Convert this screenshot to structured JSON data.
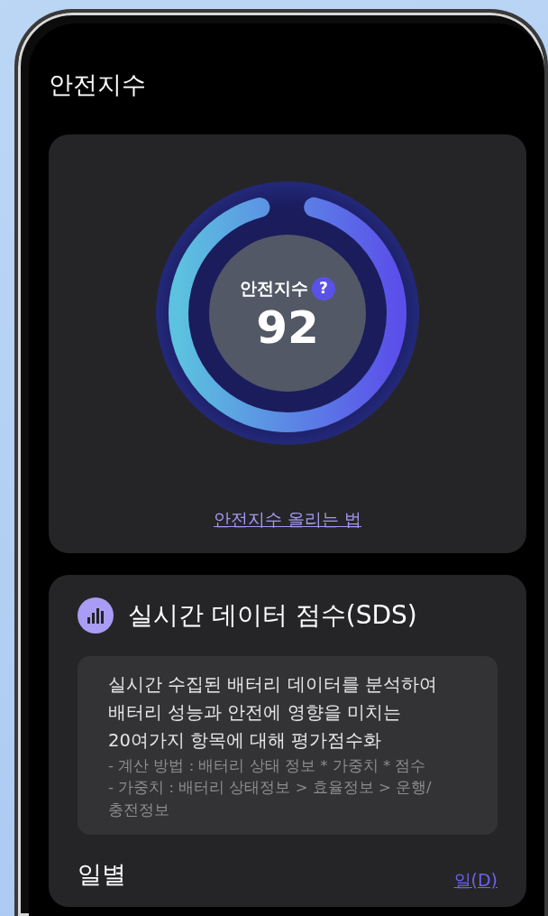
{
  "header": {
    "title": "안전지수"
  },
  "score_card": {
    "gauge": {
      "label": "안전지수",
      "help": "?",
      "score": "92",
      "level": 0.92
    },
    "link": "안전지수 올리는 법"
  },
  "sds_card": {
    "title": "실시간 데이터 점수(SDS)",
    "description": "실시간 수집된 배터리 데이터를 분석하여 배터리 성능과 안전에 영향을 미치는 20여가지 항목에 대해 평가점수화",
    "notes": [
      "- 계산 방법 : 배터리 상태 정보 * 가중치 * 점수",
      "- 가중치 : 배터리 상태정보 > 효율정보 > 운행/충전정보"
    ],
    "section": "일별",
    "period": "일(D)"
  }
}
